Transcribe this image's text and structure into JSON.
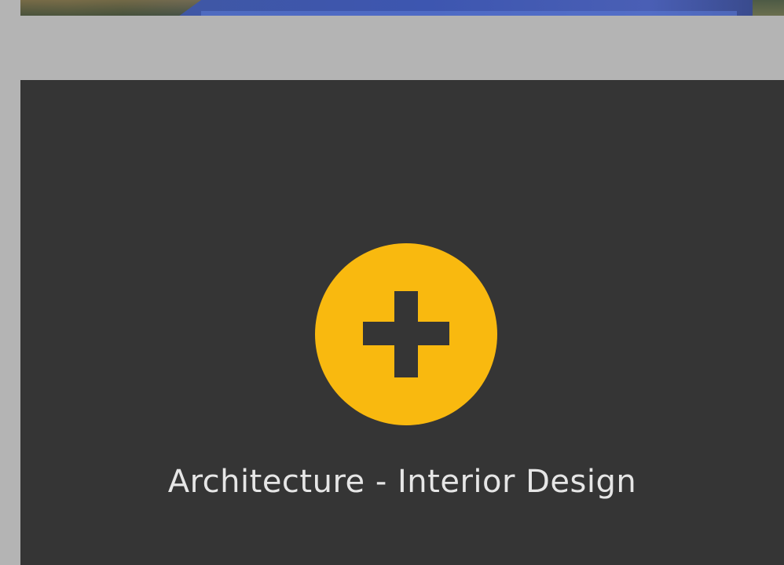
{
  "project_card": {
    "title": "Architecture - Interior Design",
    "expand_icon": "plus-icon",
    "accent_color": "#f9b90f",
    "background_color": "#353535"
  },
  "previous_tile": {
    "image": "landscape-lake-photo"
  },
  "page_background": "#b4b4b4"
}
